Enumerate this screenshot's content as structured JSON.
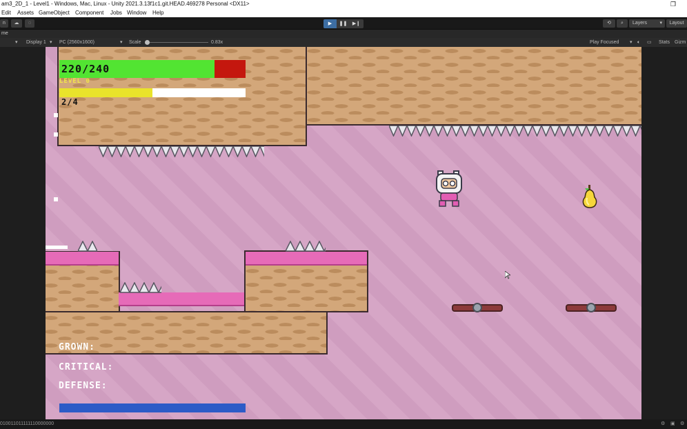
{
  "window": {
    "title": "am3_2D_1 - Level1 - Windows, Mac, Linux - Unity 2021.3.13f1c1.git.HEAD.469278 Personal <DX11>"
  },
  "menu": [
    "Edit",
    "Assets",
    "GameObject",
    "Component",
    "Jobs",
    "Window",
    "Help"
  ],
  "toolbar": {
    "account_label": "n",
    "play_icon": "play-icon",
    "pause_icon": "pause-icon",
    "step_icon": "step-icon",
    "layers_label": "Layers",
    "layout_label": "Layout"
  },
  "game_tab": {
    "label": "me"
  },
  "game_bar": {
    "display": "Display 1",
    "resolution": "PC (2560x1600)",
    "scale_label": "Scale",
    "scale_value": "0.83x",
    "play_focused": "Play Focused",
    "stats": "Stats",
    "gizmos": "Gizm"
  },
  "status": {
    "text": "010011011111110000000"
  },
  "hud": {
    "hp_text": "220/240",
    "hp_value": 220,
    "hp_max": 240,
    "level_text": "LEVEL 0",
    "xp_text": "2/4",
    "xp_value": 2,
    "xp_max": 4,
    "grown_label": "GROWN:",
    "critical_label": "CRITICAL:",
    "defense_label": "DEFENSE:"
  },
  "colors": {
    "hp_fill": "#52e432",
    "hp_empty": "#c4170e",
    "xp_fill": "#e9e32b",
    "defense_bar": "#2c5bc7",
    "background": "#d6a6c6",
    "frosting": "#e66bb8"
  }
}
